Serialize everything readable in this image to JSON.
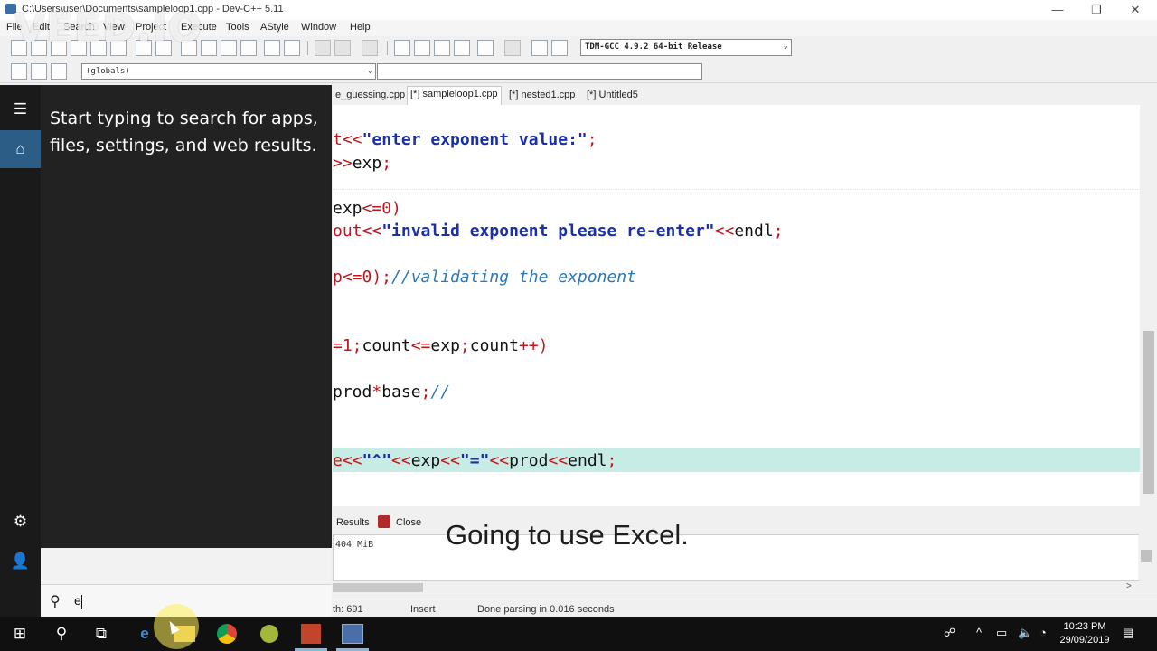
{
  "window": {
    "title": "C:\\Users\\user\\Documents\\sampleloop1.cpp - Dev-C++ 5.11",
    "minimize_glyph": "—",
    "restore_glyph": "❐",
    "close_glyph": "✕"
  },
  "watermark": "VEED.IO",
  "menu": [
    "File",
    "Edit",
    "Search",
    "View",
    "Project",
    "Execute",
    "Tools",
    "AStyle",
    "Window",
    "Help"
  ],
  "toolbar": {
    "compiler": "TDM-GCC 4.9.2 64-bit Release",
    "scope": "(globals)",
    "dropdown_arrow": "⌄"
  },
  "tabs": [
    {
      "label": "e_guessing.cpp",
      "active": false
    },
    {
      "label": "[*] sampleloop1.cpp",
      "active": true
    },
    {
      "label": "[*] nested1.cpp",
      "active": false
    },
    {
      "label": "[*] Untitled5",
      "active": false
    }
  ],
  "code": {
    "line1": [
      "t<<",
      "\"enter exponent value:\"",
      ";"
    ],
    "line2": [
      ">>",
      "exp",
      ";"
    ],
    "line3": [
      "exp",
      "<=0)"
    ],
    "line4": [
      "out<<",
      "\"invalid exponent please re-enter\"",
      "<<",
      "endl",
      ";"
    ],
    "line5": [
      "p<=0);",
      "//validating the exponent"
    ],
    "line6": [
      "=1;",
      "count",
      "<=",
      "exp",
      ";",
      "count",
      "++)"
    ],
    "line7": [
      "prod",
      "*",
      "base",
      ";",
      "//"
    ],
    "line8": [
      "e<<",
      "\"^\"",
      "<<",
      "exp",
      "<<",
      "\"=\"",
      "<<",
      "prod",
      "<<",
      "endl",
      ";"
    ]
  },
  "panel": {
    "results_label": "Results",
    "close_label": "Close",
    "log_text": "404 MiB"
  },
  "status": {
    "length": "th:  691",
    "mode": "Insert",
    "message": "Done parsing in 0.016 seconds"
  },
  "caption": "Going to use Excel.",
  "start_menu": {
    "hint": "Start typing to search for apps, files, settings, and web results.",
    "search_value": "e",
    "hamburger_glyph": "☰",
    "home_glyph": "⌂",
    "settings_glyph": "⚙",
    "user_glyph": "👤",
    "search_glyph": "⚲"
  },
  "taskbar": {
    "start_glyph": "⊞",
    "search_glyph": "⚲",
    "taskview_glyph": "⧉",
    "edge_glyph": "e",
    "people_glyph": "☍",
    "chevron_glyph": "^",
    "battery_glyph": "▭",
    "volume_glyph": "🔈",
    "network_glyph": "◔",
    "notify_glyph": "▤",
    "time": "10:23 PM",
    "date": "29/09/2019"
  }
}
